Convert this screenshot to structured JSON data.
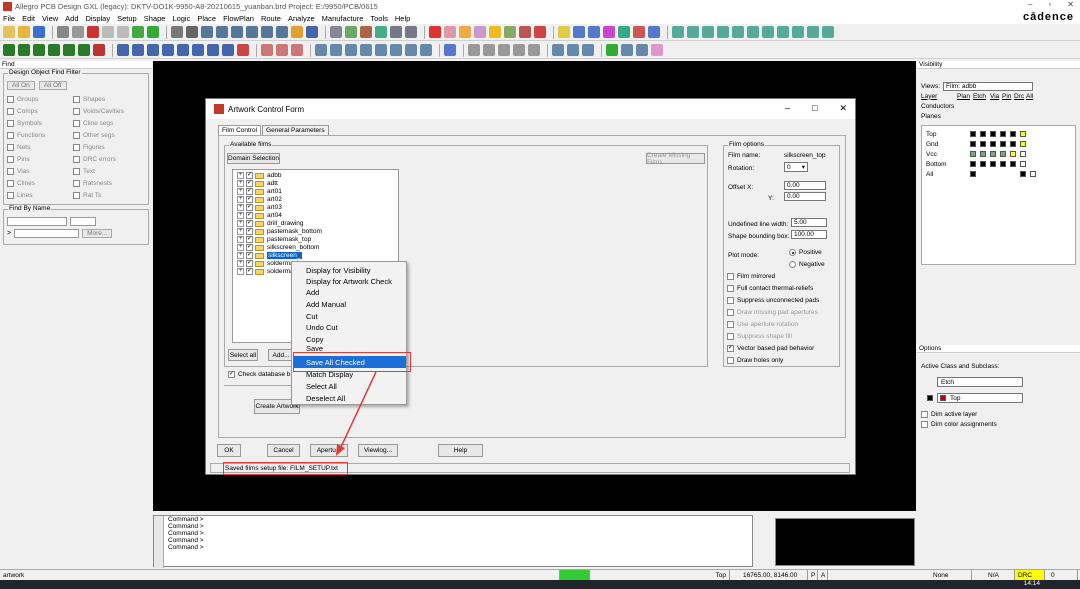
{
  "window": {
    "title": "Allegro PCB Design GXL (legacy): DKTV-DO1K-9950-A8-20210615_yuanban.brd  Project: E:/9950/PCB/0615",
    "brand": "cādence"
  },
  "menu": [
    "File",
    "Edit",
    "View",
    "Add",
    "Display",
    "Setup",
    "Shape",
    "Logic",
    "Place",
    "FlowPlan",
    "Route",
    "Analyze",
    "Manufacture",
    "Tools",
    "Help"
  ],
  "find_panel": {
    "header": "Find",
    "group_title": "Design Object Find Filter",
    "all_on": "All On",
    "all_off": "All Off",
    "items": [
      [
        "Groups",
        "Shapes"
      ],
      [
        "Comps",
        "Voids/Cavities"
      ],
      [
        "Symbols",
        "Cline segs"
      ],
      [
        "Functions",
        "Other segs"
      ],
      [
        "Nets",
        "Figures"
      ],
      [
        "Pins",
        "DRC errors"
      ],
      [
        "Vias",
        "Text"
      ],
      [
        "Clines",
        "Ratsnests"
      ],
      [
        "Lines",
        "Rat Ts"
      ]
    ],
    "find_by_name": "Find By Name",
    "more": "More..."
  },
  "visibility_panel": {
    "header": "Visibility",
    "views_label": "Views:",
    "views_value": "Film: adbb",
    "cols": [
      "Layer",
      "Plan",
      "Etch",
      "Via",
      "Pin",
      "Drc",
      "All"
    ],
    "conductors": "Conductors",
    "planes": "Planes",
    "layers": [
      "Top",
      "Gnd",
      "Vcc",
      "Bottom",
      "All"
    ]
  },
  "options_panel": {
    "header": "Options",
    "active_class": "Active Class and Subclass:",
    "class_value": "Etch",
    "subclass_value": "Top",
    "dim_active": "Dim active layer",
    "dim_color": "Dim color assignments"
  },
  "dialog": {
    "title": "Artwork Control Form",
    "tabs": [
      "Film Control",
      "General Parameters"
    ],
    "available_films": "Available films",
    "domain_selection": "Domain Selection",
    "create_missing": "Create Missing Films",
    "films": [
      "adbb",
      "adtt",
      "art01",
      "art02",
      "art03",
      "art04",
      "drill_drawing",
      "pastemask_bottom",
      "pastemask_top",
      "silkscreen_bottom",
      "silkscreen_top",
      "soldermask_bottom",
      "soldermask_top"
    ],
    "films_visible": [
      "adbb",
      "adtt",
      "art01",
      "art02",
      "art03",
      "art04",
      "drill_drawing",
      "pastemask_bottom",
      "pastemask_top",
      "silkscreen_bottom",
      "silkscreen_",
      "soldermasl",
      "soldermasl"
    ],
    "select_all": "Select all",
    "add": "Add...",
    "check_db": "Check database b",
    "create_artwork": "Create Artwork",
    "film_options": "Film options",
    "film_name_label": "Film name:",
    "film_name_value": "silkscreen_top",
    "rotation_label": "Rotation:",
    "rotation_value": "0",
    "offset_x_label": "Offset   X:",
    "offset_x": "0.00",
    "offset_y_label": "Y:",
    "offset_y": "0.00",
    "undef_line_label": "Undefined line width:",
    "undef_line": "5.00",
    "shape_bbox_label": "Shape bounding box:",
    "shape_bbox": "100.00",
    "plot_mode_label": "Plot mode:",
    "positive": "Positive",
    "negative": "Negative",
    "options": [
      {
        "label": "Film mirrored",
        "dim": false,
        "checked": false
      },
      {
        "label": "Full contact thermal-reliefs",
        "dim": false,
        "checked": false
      },
      {
        "label": "Suppress unconnected pads",
        "dim": false,
        "checked": false
      },
      {
        "label": "Draw missing pad apertures",
        "dim": true,
        "checked": false
      },
      {
        "label": "Use aperture rotation",
        "dim": true,
        "checked": false
      },
      {
        "label": "Suppress shape fill",
        "dim": true,
        "checked": false
      },
      {
        "label": "Vector based pad behavior",
        "dim": false,
        "checked": true
      },
      {
        "label": "Draw holes only",
        "dim": false,
        "checked": false
      }
    ],
    "buttons": {
      "ok": "OK",
      "cancel": "Cancel",
      "apertures": "Apertu...",
      "viewlog": "Viewlog...",
      "help": "Help"
    },
    "status": "Saved films setup file: FILM_SETUP.txt"
  },
  "context_menu": [
    "Display for Visibility",
    "Display for Artwork Check",
    "Add",
    "Add Manual",
    "Cut",
    "Undo Cut",
    "Copy",
    "Save",
    "Save All Checked",
    "Match Display",
    "Select All",
    "Deselect All"
  ],
  "context_menu_highlight": "Save All Checked",
  "command": {
    "lines": [
      "Command >",
      "Command >",
      "Command >",
      "Command >",
      "Command >"
    ],
    "side_label": "Command"
  },
  "statusbar": {
    "left": "artwork",
    "layer": "Top",
    "coords": "16765.00, 8146.00",
    "p": "P",
    "a": "A",
    "none": "None",
    "na": "N/A",
    "drc": "DRC",
    "drc_count": "0",
    "time": "14:14"
  }
}
